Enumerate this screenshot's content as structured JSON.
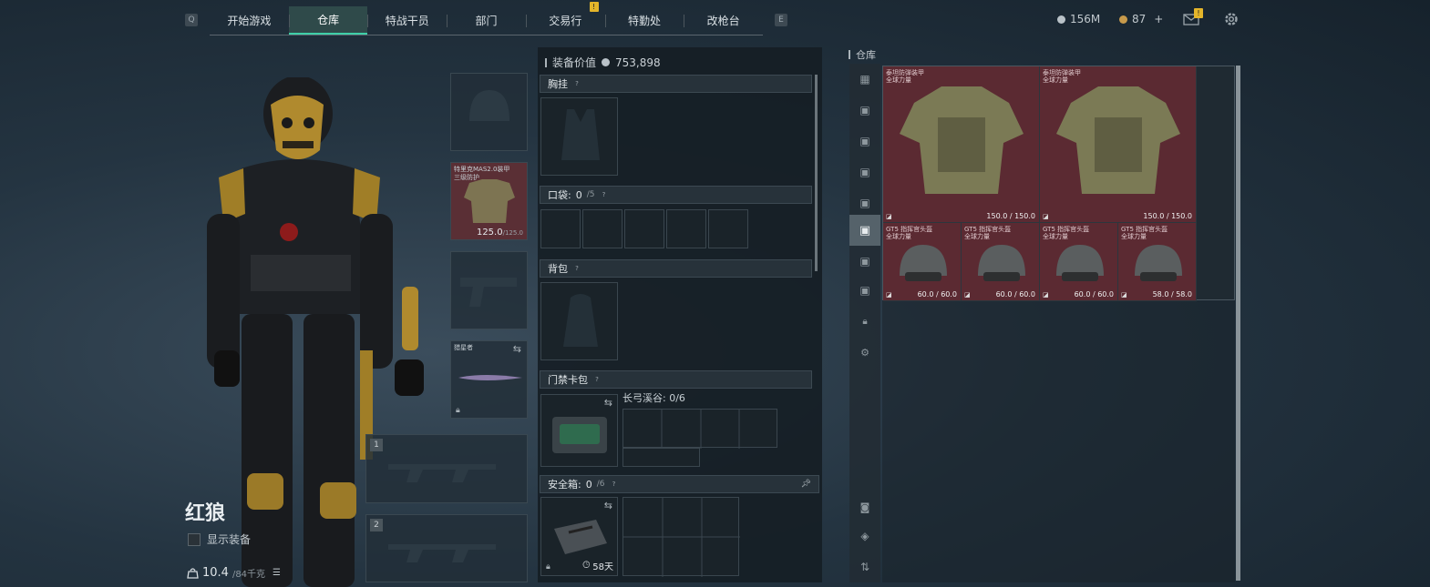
{
  "tabs": [
    {
      "label": "开始游戏"
    },
    {
      "label": "仓库"
    },
    {
      "label": "特战干员"
    },
    {
      "label": "部门"
    },
    {
      "label": "交易行"
    },
    {
      "label": "特勤处"
    },
    {
      "label": "改枪台"
    }
  ],
  "nav": {
    "left_key": "Q",
    "right_key": "E",
    "tab_badge": "!",
    "mail_badge": "!"
  },
  "currency": {
    "silver": "156M",
    "gold": "87",
    "plus": "+"
  },
  "character": {
    "name": "红狼",
    "show_gear_label": "显示装备",
    "weight": "10.4",
    "weight_max": "/84千克"
  },
  "slots": {
    "armor_label": "特里克MAS2.0装甲\n三级防护",
    "armor_durability": "125.0",
    "armor_max": "/125.0",
    "melee_label": "猎星者",
    "primary1_num": "1",
    "primary2_num": "2"
  },
  "equipment": {
    "title": "装备价值",
    "value": "753,898",
    "chest_rig": "胸挂",
    "pockets": "口袋:",
    "pockets_count": "0",
    "pockets_max": "/5",
    "backpack": "背包",
    "keycard": "门禁卡包",
    "keycard_sub": "长弓溪谷: 0/6",
    "safe_box": "安全箱:",
    "safe_count": "0",
    "safe_max": "/6",
    "safe_timer": "58天",
    "help": "?"
  },
  "warehouse": {
    "title": "仓库",
    "items": [
      {
        "name": "泰坦防弹装甲\n全球力量",
        "durability": "150.0 / 150.0"
      },
      {
        "name": "泰坦防弹装甲\n全球力量",
        "durability": "150.0 / 150.0"
      },
      {
        "name": "GT5 指挥官头盔\n全球力量",
        "durability": "60.0 / 60.0"
      },
      {
        "name": "GT5 指挥官头盔\n全球力量",
        "durability": "60.0 / 60.0"
      },
      {
        "name": "GT5 指挥官头盔\n全球力量",
        "durability": "60.0 / 60.0"
      },
      {
        "name": "GT5 指挥官头盔\n全球力量",
        "durability": "58.0 / 58.0"
      }
    ]
  },
  "colors": {
    "accent": "#3fd0a8",
    "item_bg": "#5b2a32",
    "badge": "#e4b52a"
  }
}
